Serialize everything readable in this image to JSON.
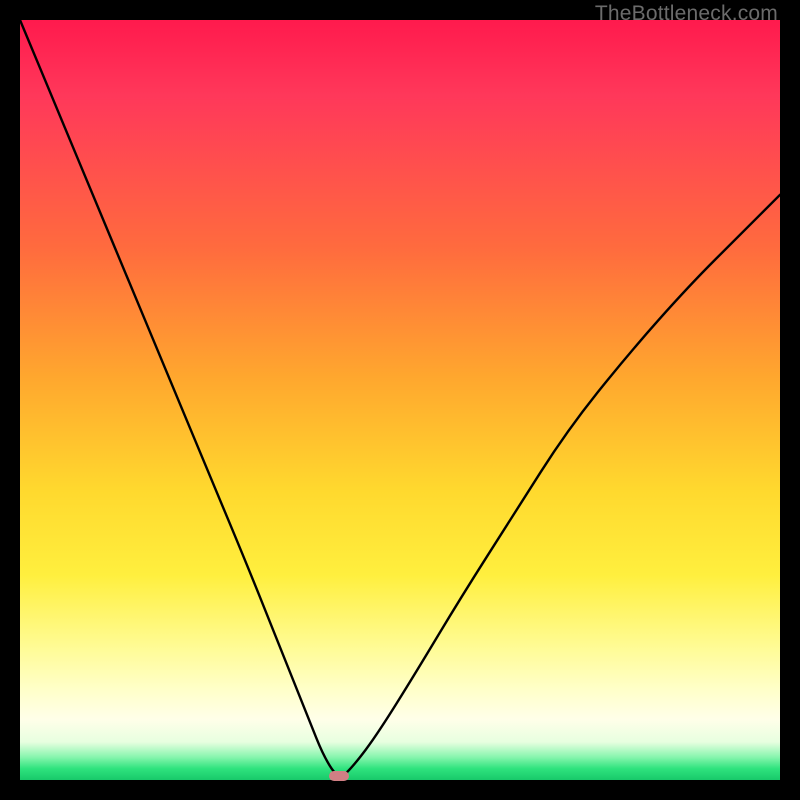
{
  "watermark": "TheBottleneck.com",
  "colors": {
    "frame": "#000000",
    "curve": "#000000",
    "marker": "#d17f84",
    "gradient_top": "#ff1a4d",
    "gradient_mid": "#ffd92e",
    "gradient_bottom": "#18c96a"
  },
  "chart_data": {
    "type": "line",
    "title": "",
    "xlabel": "",
    "ylabel": "",
    "xlim": [
      0,
      100
    ],
    "ylim": [
      0,
      100
    ],
    "note": "V-shaped bottleneck curve. y-axis is inverted visually (0 at bottom = optimal / green). Minimum (best match) at roughly x=42, y≈0.",
    "series": [
      {
        "name": "bottleneck-curve",
        "x": [
          0,
          5,
          10,
          15,
          20,
          25,
          30,
          34,
          38,
          40,
          42,
          44,
          47,
          52,
          58,
          65,
          72,
          80,
          88,
          95,
          100
        ],
        "y": [
          100,
          88,
          76,
          64,
          52,
          40,
          28,
          18,
          8,
          3,
          0,
          2,
          6,
          14,
          24,
          35,
          46,
          56,
          65,
          72,
          77
        ]
      }
    ],
    "minimum_point": {
      "x": 42,
      "y": 0
    }
  }
}
